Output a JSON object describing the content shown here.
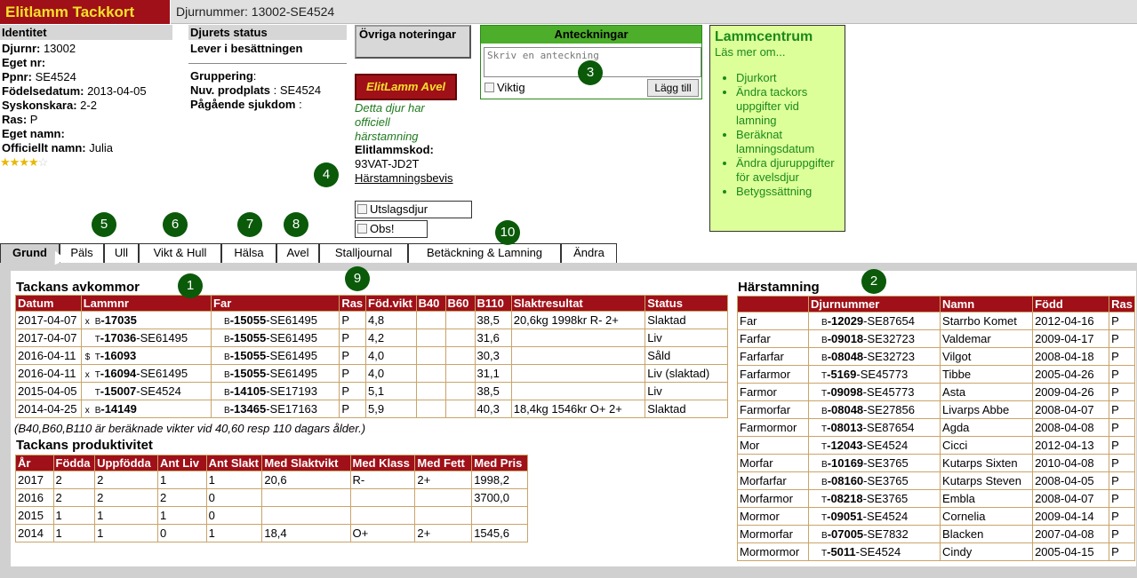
{
  "header": {
    "brand": "Elitlamm Tackkort",
    "djurnummer": "Djurnummer: 13002-SE4524"
  },
  "identitet": {
    "title": "Identitet",
    "fields": [
      {
        "label": "Djurnr:",
        "value": " 13002"
      },
      {
        "label": "Eget nr:",
        "value": ""
      },
      {
        "label": "Ppnr:",
        "value": " SE4524"
      },
      {
        "label": "Födelsedatum:",
        "value": " 2013-04-05"
      },
      {
        "label": "Syskonskara:",
        "value": " 2-2"
      },
      {
        "label": "Ras:",
        "value": " P"
      },
      {
        "label": "Eget namn:",
        "value": ""
      },
      {
        "label": "Officiellt namn:",
        "value": " Julia"
      }
    ],
    "rating": 4,
    "rating_max": 5
  },
  "status": {
    "title": "Djurets status",
    "state": "Lever i besättningen",
    "fields": [
      {
        "label": "Gruppering",
        "value": ":"
      },
      {
        "label": "Nuv. prodplats",
        "value": " : SE4524"
      },
      {
        "label": "Pågående sjukdom",
        "value": " :"
      }
    ]
  },
  "ovriga": "Övriga noteringar",
  "avel": {
    "button": "ElitLamm Avel",
    "note": "Detta djur har officiell härstamning",
    "kod_label": "Elitlammskod:",
    "kod": "93VAT-JD2T",
    "harstamning_link": "Härstamningsbevis"
  },
  "checks": {
    "utslag": "Utslagsdjur",
    "obs": "Obs!"
  },
  "anteckningar": {
    "title": "Anteckningar",
    "placeholder": "Skriv en anteckning",
    "viktig": "Viktig",
    "button": "Lägg till"
  },
  "lammcentrum": {
    "title": "Lammcentrum",
    "sub": "Läs mer om...",
    "links": [
      "Djurkort",
      "Ändra tackors uppgifter vid lamning",
      "Beräknat lamningsdatum",
      "Ändra djuruppgifter för avelsdjur",
      "Betygssättning"
    ]
  },
  "badges": [
    "1",
    "2",
    "3",
    "4",
    "5",
    "6",
    "7",
    "8",
    "9",
    "10"
  ],
  "tabs": [
    "Grund",
    "Päls",
    "Ull",
    "Vikt & Hull",
    "Hälsa",
    "Avel",
    "Stalljournal",
    "Betäckning & Lamning",
    "Ändra"
  ],
  "avkommor": {
    "title": "Tackans avkommor",
    "headers": [
      "Datum",
      "Lammnr",
      "Far",
      "Ras",
      "Föd.vikt",
      "B40",
      "B60",
      "B110",
      "Slaktresultat",
      "Status"
    ],
    "rows": [
      {
        "datum": "2017-04-07",
        "mark": "x",
        "sex": "B",
        "lamm": "17035",
        "lamm_suffix": "",
        "far_sex": "B",
        "far": "15055",
        "far_suffix": "-SE61495",
        "ras": "P",
        "fod": "4,8",
        "b40": "",
        "b60": "",
        "b110": "38,5",
        "slakt": "20,6kg 1998kr R- 2+",
        "status": "Slaktad"
      },
      {
        "datum": "2017-04-07",
        "mark": "",
        "sex": "T",
        "lamm": "17036",
        "lamm_suffix": "-SE61495",
        "far_sex": "B",
        "far": "15055",
        "far_suffix": "-SE61495",
        "ras": "P",
        "fod": "4,2",
        "b40": "",
        "b60": "",
        "b110": "31,6",
        "slakt": "",
        "status": "Liv"
      },
      {
        "datum": "2016-04-11",
        "mark": "$",
        "sex": "T",
        "lamm": "16093",
        "lamm_suffix": "",
        "far_sex": "B",
        "far": "15055",
        "far_suffix": "-SE61495",
        "ras": "P",
        "fod": "4,0",
        "b40": "",
        "b60": "",
        "b110": "30,3",
        "slakt": "",
        "status": "Såld"
      },
      {
        "datum": "2016-04-11",
        "mark": "x",
        "sex": "T",
        "lamm": "16094",
        "lamm_suffix": "-SE61495",
        "far_sex": "B",
        "far": "15055",
        "far_suffix": "-SE61495",
        "ras": "P",
        "fod": "4,0",
        "b40": "",
        "b60": "",
        "b110": "31,1",
        "slakt": "",
        "status": "Liv (slaktad)"
      },
      {
        "datum": "2015-04-05",
        "mark": "",
        "sex": "T",
        "lamm": "15007",
        "lamm_suffix": "-SE4524",
        "far_sex": "B",
        "far": "14105",
        "far_suffix": "-SE17193",
        "ras": "P",
        "fod": "5,1",
        "b40": "",
        "b60": "",
        "b110": "38,5",
        "slakt": "",
        "status": "Liv"
      },
      {
        "datum": "2014-04-25",
        "mark": "x",
        "sex": "B",
        "lamm": "14149",
        "lamm_suffix": "",
        "far_sex": "B",
        "far": "13465",
        "far_suffix": "-SE17163",
        "ras": "P",
        "fod": "5,9",
        "b40": "",
        "b60": "",
        "b110": "40,3",
        "slakt": "18,4kg 1546kr O+ 2+",
        "status": "Slaktad"
      }
    ],
    "note": "(B40,B60,B110 är beräknade vikter vid 40,60 resp 110 dagars ålder.)"
  },
  "produktivitet": {
    "title": "Tackans produktivitet",
    "headers": [
      "År",
      "Födda",
      "Uppfödda",
      "Ant Liv",
      "Ant Slakt",
      "Med Slaktvikt",
      "Med Klass",
      "Med Fett",
      "Med Pris"
    ],
    "rows": [
      [
        "2017",
        "2",
        "2",
        "1",
        "1",
        "20,6",
        "R-",
        "2+",
        "1998,2"
      ],
      [
        "2016",
        "2",
        "2",
        "2",
        "0",
        "",
        "",
        "",
        "3700,0"
      ],
      [
        "2015",
        "1",
        "1",
        "1",
        "0",
        "",
        "",
        "",
        ""
      ],
      [
        "2014",
        "1",
        "1",
        "0",
        "1",
        "18,4",
        "O+",
        "2+",
        "1545,6"
      ]
    ]
  },
  "harstamning": {
    "title": "Härstamning",
    "headers": [
      "",
      "Djurnummer",
      "Namn",
      "Född",
      "Ras"
    ],
    "rows": [
      {
        "rel": "Far",
        "sex": "B",
        "nr": "12029",
        "suffix": "-SE87654",
        "namn": "Starrbo Komet",
        "fodd": "2012-04-16",
        "ras": "P"
      },
      {
        "rel": "Farfar",
        "sex": "B",
        "nr": "09018",
        "suffix": "-SE32723",
        "namn": "Valdemar",
        "fodd": "2009-04-17",
        "ras": "P"
      },
      {
        "rel": "Farfarfar",
        "sex": "B",
        "nr": "08048",
        "suffix": "-SE32723",
        "namn": "Vilgot",
        "fodd": "2008-04-18",
        "ras": "P"
      },
      {
        "rel": "Farfarmor",
        "sex": "T",
        "nr": "5169",
        "suffix": "-SE45773",
        "namn": "Tibbe",
        "fodd": "2005-04-26",
        "ras": "P"
      },
      {
        "rel": "Farmor",
        "sex": "T",
        "nr": "09098",
        "suffix": "-SE45773",
        "namn": "Asta",
        "fodd": "2009-04-26",
        "ras": "P"
      },
      {
        "rel": "Farmorfar",
        "sex": "B",
        "nr": "08048",
        "suffix": "-SE27856",
        "namn": "Livarps Abbe",
        "fodd": "2008-04-07",
        "ras": "P"
      },
      {
        "rel": "Farmormor",
        "sex": "T",
        "nr": "08013",
        "suffix": "-SE87654",
        "namn": "Agda",
        "fodd": "2008-04-08",
        "ras": "P"
      },
      {
        "rel": "Mor",
        "sex": "T",
        "nr": "12043",
        "suffix": "-SE4524",
        "namn": "Cicci",
        "fodd": "2012-04-13",
        "ras": "P"
      },
      {
        "rel": "Morfar",
        "sex": "B",
        "nr": "10169",
        "suffix": "-SE3765",
        "namn": "Kutarps Sixten",
        "fodd": "2010-04-08",
        "ras": "P"
      },
      {
        "rel": "Morfarfar",
        "sex": "B",
        "nr": "08160",
        "suffix": "-SE3765",
        "namn": "Kutarps Steven",
        "fodd": "2008-04-05",
        "ras": "P"
      },
      {
        "rel": "Morfarmor",
        "sex": "T",
        "nr": "08218",
        "suffix": "-SE3765",
        "namn": "Embla",
        "fodd": "2008-04-07",
        "ras": "P"
      },
      {
        "rel": "Mormor",
        "sex": "T",
        "nr": "09051",
        "suffix": "-SE4524",
        "namn": "Cornelia",
        "fodd": "2009-04-14",
        "ras": "P"
      },
      {
        "rel": "Mormorfar",
        "sex": "B",
        "nr": "07005",
        "suffix": "-SE7832",
        "namn": "Blacken",
        "fodd": "2007-04-08",
        "ras": "P"
      },
      {
        "rel": "Mormormor",
        "sex": "T",
        "nr": "5011",
        "suffix": "-SE4524",
        "namn": "Cindy",
        "fodd": "2005-04-15",
        "ras": "P"
      }
    ]
  }
}
